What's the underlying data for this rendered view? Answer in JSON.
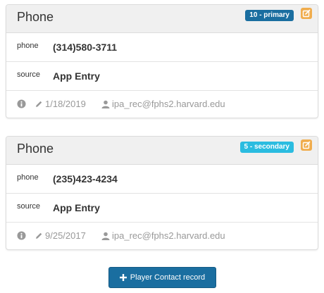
{
  "cards": [
    {
      "title": "Phone",
      "badge": "10 - primary",
      "badge_color": "#1a6ea0",
      "rows": [
        {
          "label": "phone",
          "value": "(314)580-3711"
        },
        {
          "label": "source",
          "value": "App Entry"
        }
      ],
      "footer": {
        "date": "1/18/2019",
        "user": "ipa_rec@fphs2.harvard.edu"
      }
    },
    {
      "title": "Phone",
      "badge": "5 - secondary",
      "badge_color": "#2bbce0",
      "rows": [
        {
          "label": "phone",
          "value": "(235)423-4234"
        },
        {
          "label": "source",
          "value": "App Entry"
        }
      ],
      "footer": {
        "date": "9/25/2017",
        "user": "ipa_rec@fphs2.harvard.edu"
      }
    }
  ],
  "add_button": {
    "label": "Player Contact record",
    "icon": "plus-icon"
  },
  "icons": {
    "info": "info-icon",
    "edit_date": "pencil-icon",
    "user": "user-icon",
    "edit": "edit-icon"
  },
  "colors": {
    "edit_button": "#f0ad4e",
    "add_button": "#1a6ea0",
    "muted_text": "#999999"
  }
}
